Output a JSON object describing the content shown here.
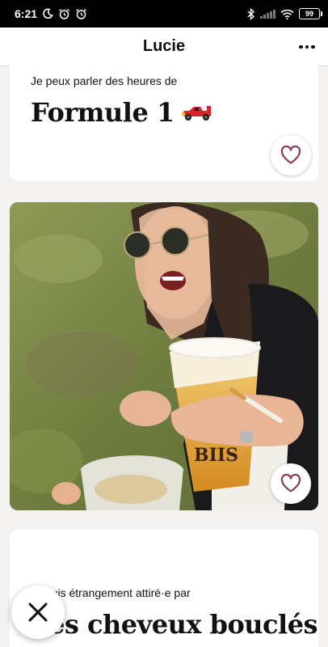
{
  "status_bar": {
    "time": "6:21",
    "battery": "99",
    "left_icons": [
      "moon-icon",
      "alarm-icon",
      "alarm-icon"
    ],
    "right_icons": [
      "bluetooth-icon",
      "signal-icon",
      "wifi-icon",
      "battery-icon"
    ]
  },
  "header": {
    "title": "Lucie",
    "menu_icon": "more-horizontal-icon"
  },
  "prompts": [
    {
      "label": "Je peux parler des heures de",
      "answer": "Formule 1",
      "emoji": "race-car-icon"
    },
    {
      "label": "Je suis étrangement attiré·e par",
      "answer": "Les cheveux bouclés"
    }
  ],
  "photo": {
    "icon": "photo-of-woman-holding-beer"
  },
  "colors": {
    "accent": "#8a3b52",
    "background": "#f3f2f1"
  }
}
